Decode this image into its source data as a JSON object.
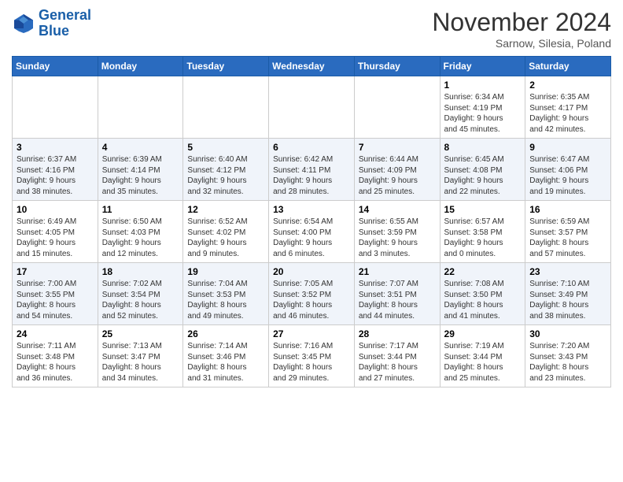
{
  "header": {
    "logo_line1": "General",
    "logo_line2": "Blue",
    "month": "November 2024",
    "location": "Sarnow, Silesia, Poland"
  },
  "weekdays": [
    "Sunday",
    "Monday",
    "Tuesday",
    "Wednesday",
    "Thursday",
    "Friday",
    "Saturday"
  ],
  "weeks": [
    [
      {
        "day": "",
        "info": ""
      },
      {
        "day": "",
        "info": ""
      },
      {
        "day": "",
        "info": ""
      },
      {
        "day": "",
        "info": ""
      },
      {
        "day": "",
        "info": ""
      },
      {
        "day": "1",
        "info": "Sunrise: 6:34 AM\nSunset: 4:19 PM\nDaylight: 9 hours\nand 45 minutes."
      },
      {
        "day": "2",
        "info": "Sunrise: 6:35 AM\nSunset: 4:17 PM\nDaylight: 9 hours\nand 42 minutes."
      }
    ],
    [
      {
        "day": "3",
        "info": "Sunrise: 6:37 AM\nSunset: 4:16 PM\nDaylight: 9 hours\nand 38 minutes."
      },
      {
        "day": "4",
        "info": "Sunrise: 6:39 AM\nSunset: 4:14 PM\nDaylight: 9 hours\nand 35 minutes."
      },
      {
        "day": "5",
        "info": "Sunrise: 6:40 AM\nSunset: 4:12 PM\nDaylight: 9 hours\nand 32 minutes."
      },
      {
        "day": "6",
        "info": "Sunrise: 6:42 AM\nSunset: 4:11 PM\nDaylight: 9 hours\nand 28 minutes."
      },
      {
        "day": "7",
        "info": "Sunrise: 6:44 AM\nSunset: 4:09 PM\nDaylight: 9 hours\nand 25 minutes."
      },
      {
        "day": "8",
        "info": "Sunrise: 6:45 AM\nSunset: 4:08 PM\nDaylight: 9 hours\nand 22 minutes."
      },
      {
        "day": "9",
        "info": "Sunrise: 6:47 AM\nSunset: 4:06 PM\nDaylight: 9 hours\nand 19 minutes."
      }
    ],
    [
      {
        "day": "10",
        "info": "Sunrise: 6:49 AM\nSunset: 4:05 PM\nDaylight: 9 hours\nand 15 minutes."
      },
      {
        "day": "11",
        "info": "Sunrise: 6:50 AM\nSunset: 4:03 PM\nDaylight: 9 hours\nand 12 minutes."
      },
      {
        "day": "12",
        "info": "Sunrise: 6:52 AM\nSunset: 4:02 PM\nDaylight: 9 hours\nand 9 minutes."
      },
      {
        "day": "13",
        "info": "Sunrise: 6:54 AM\nSunset: 4:00 PM\nDaylight: 9 hours\nand 6 minutes."
      },
      {
        "day": "14",
        "info": "Sunrise: 6:55 AM\nSunset: 3:59 PM\nDaylight: 9 hours\nand 3 minutes."
      },
      {
        "day": "15",
        "info": "Sunrise: 6:57 AM\nSunset: 3:58 PM\nDaylight: 9 hours\nand 0 minutes."
      },
      {
        "day": "16",
        "info": "Sunrise: 6:59 AM\nSunset: 3:57 PM\nDaylight: 8 hours\nand 57 minutes."
      }
    ],
    [
      {
        "day": "17",
        "info": "Sunrise: 7:00 AM\nSunset: 3:55 PM\nDaylight: 8 hours\nand 54 minutes."
      },
      {
        "day": "18",
        "info": "Sunrise: 7:02 AM\nSunset: 3:54 PM\nDaylight: 8 hours\nand 52 minutes."
      },
      {
        "day": "19",
        "info": "Sunrise: 7:04 AM\nSunset: 3:53 PM\nDaylight: 8 hours\nand 49 minutes."
      },
      {
        "day": "20",
        "info": "Sunrise: 7:05 AM\nSunset: 3:52 PM\nDaylight: 8 hours\nand 46 minutes."
      },
      {
        "day": "21",
        "info": "Sunrise: 7:07 AM\nSunset: 3:51 PM\nDaylight: 8 hours\nand 44 minutes."
      },
      {
        "day": "22",
        "info": "Sunrise: 7:08 AM\nSunset: 3:50 PM\nDaylight: 8 hours\nand 41 minutes."
      },
      {
        "day": "23",
        "info": "Sunrise: 7:10 AM\nSunset: 3:49 PM\nDaylight: 8 hours\nand 38 minutes."
      }
    ],
    [
      {
        "day": "24",
        "info": "Sunrise: 7:11 AM\nSunset: 3:48 PM\nDaylight: 8 hours\nand 36 minutes."
      },
      {
        "day": "25",
        "info": "Sunrise: 7:13 AM\nSunset: 3:47 PM\nDaylight: 8 hours\nand 34 minutes."
      },
      {
        "day": "26",
        "info": "Sunrise: 7:14 AM\nSunset: 3:46 PM\nDaylight: 8 hours\nand 31 minutes."
      },
      {
        "day": "27",
        "info": "Sunrise: 7:16 AM\nSunset: 3:45 PM\nDaylight: 8 hours\nand 29 minutes."
      },
      {
        "day": "28",
        "info": "Sunrise: 7:17 AM\nSunset: 3:44 PM\nDaylight: 8 hours\nand 27 minutes."
      },
      {
        "day": "29",
        "info": "Sunrise: 7:19 AM\nSunset: 3:44 PM\nDaylight: 8 hours\nand 25 minutes."
      },
      {
        "day": "30",
        "info": "Sunrise: 7:20 AM\nSunset: 3:43 PM\nDaylight: 8 hours\nand 23 minutes."
      }
    ]
  ]
}
